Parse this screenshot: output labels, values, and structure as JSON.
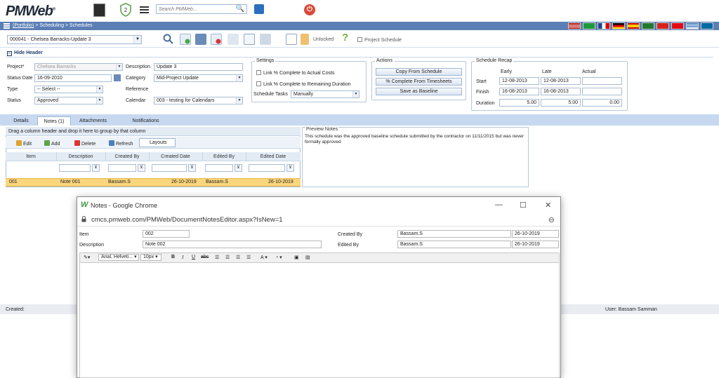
{
  "app": {
    "logo_main": "PMWeb",
    "search_placeholder": "Search PMWeb...",
    "notification_count": "2",
    "power_glyph": "⏻",
    "search_glyph": "🔍"
  },
  "breadcrumb": {
    "portfolio": "(Portfolio)",
    "rest": " > Scheduling > Schedules"
  },
  "toolbar": {
    "record": "000041 - Chelsea Barracks-Update 3",
    "unlocked": "Unlocked",
    "project_schedule": "Project Schedule"
  },
  "header": {
    "hide_label": "Hide Header",
    "project_label": "Project*",
    "project_value": "Chelsea Barracks",
    "status_date_label": "Status Date",
    "status_date_value": "16-09-2010",
    "type_label": "Type",
    "type_value": "-- Select --",
    "status_label": "Status",
    "status_value": "Approved",
    "description_label": "Description",
    "description_value": "Update 3",
    "category_label": "Category",
    "category_value": "Mid-Project Update",
    "reference_label": "Reference",
    "reference_value": "",
    "calendar_label": "Calendar",
    "calendar_value": "003 - testing for Calendars"
  },
  "settings": {
    "title": "Settings",
    "link_actual": "Link % Complete to Actual Costs",
    "link_remaining": "Link % Complete to Remaining Duration",
    "tasks_label": "Schedule Tasks",
    "tasks_value": "Manually"
  },
  "actions": {
    "title": "Actions",
    "copy": "Copy From Schedule",
    "pct": "% Complete From Timesheets",
    "save": "Save as Baseline"
  },
  "recap": {
    "title": "Schedule Recap",
    "col_early": "Early",
    "col_late": "Late",
    "col_actual": "Actual",
    "start_label": "Start",
    "finish_label": "Finish",
    "duration_label": "Duration",
    "start_early": "12-08-2013",
    "start_late": "12-08-2013",
    "start_actual": "",
    "finish_early": "16-08-2013",
    "finish_late": "16-08-2013",
    "finish_actual": "",
    "dur_early": "5.00",
    "dur_late": "5.00",
    "dur_actual": "0.00"
  },
  "tabs": {
    "details": "Details",
    "notes": "Notes (1)",
    "attachments": "Attachments",
    "notifications": "Notifications"
  },
  "grid": {
    "group_hint": "Drag a column header and drop it here to group by that column",
    "edit": "Edit",
    "add": "Add",
    "delete": "Delete",
    "refresh": "Refresh",
    "layouts": "Layouts",
    "columns": [
      "Item",
      "Description",
      "Created By",
      "Created Date",
      "Edited By",
      "Edited Date"
    ],
    "row": {
      "item": "001",
      "description": "Note 001",
      "created_by": "Bassam.S",
      "created_date": "26-10-2019",
      "edited_by": "Bassam.S",
      "edited_date": "26-10-2019"
    }
  },
  "preview": {
    "title": "Preview Notes",
    "text": "This schedule was the approved baseline schedule submitted by the contractor on 11/11/2015 but was never formally approved"
  },
  "footer": {
    "created": "Created:",
    "user": "User:  Bassam Samman"
  },
  "popup": {
    "title": "Notes - Google Chrome",
    "url": "cmcs.pmweb.com/PMWeb/DocumentNotesEditor.aspx?IsNew=1",
    "item_label": "Item",
    "item_value": "002",
    "description_label": "Description",
    "description_value": "Note 002",
    "created_by_label": "Created By",
    "created_by_value": "Bassam.S",
    "created_date_value": "26-10-2019",
    "edited_by_label": "Edited By",
    "edited_by_value": "Bassam.S",
    "edited_date_value": "26-10-2019",
    "font_name": "Arial, Helveti...",
    "font_size": "10px",
    "minimize": "—",
    "maximize": "☐",
    "close": "✕"
  }
}
